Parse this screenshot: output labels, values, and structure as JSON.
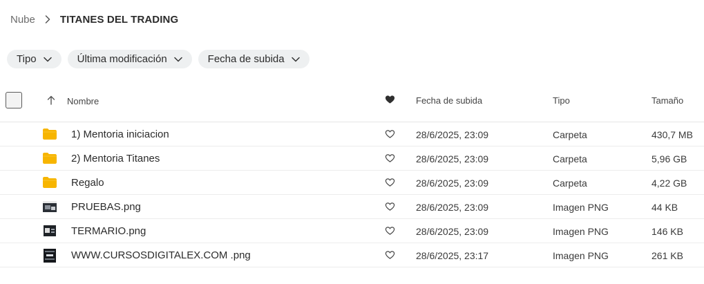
{
  "breadcrumb": {
    "root": "Nube",
    "current": "TITANES DEL TRADING"
  },
  "filters": [
    {
      "label": "Tipo"
    },
    {
      "label": "Última modificación"
    },
    {
      "label": "Fecha de subida"
    }
  ],
  "table": {
    "headers": {
      "name": "Nombre",
      "date": "Fecha de subida",
      "type": "Tipo",
      "size": "Tamaño"
    },
    "rows": [
      {
        "icon": "folder-icon",
        "name": "1) Mentoria iniciacion",
        "date": "28/6/2025, 23:09",
        "type": "Carpeta",
        "size": "430,7 MB"
      },
      {
        "icon": "folder-icon",
        "name": "2) Mentoria Titanes",
        "date": "28/6/2025, 23:09",
        "type": "Carpeta",
        "size": "5,96 GB"
      },
      {
        "icon": "folder-icon",
        "name": "Regalo",
        "date": "28/6/2025, 23:09",
        "type": "Carpeta",
        "size": "4,22 GB"
      },
      {
        "icon": "image-thumbnail-icon",
        "name": "PRUEBAS.png",
        "date": "28/6/2025, 23:09",
        "type": "Imagen PNG",
        "size": "44 KB"
      },
      {
        "icon": "image-thumbnail-icon",
        "name": "TERMARIO.png",
        "date": "28/6/2025, 23:09",
        "type": "Imagen PNG",
        "size": "146 KB"
      },
      {
        "icon": "image-thumbnail-icon",
        "name": "WWW.CURSOSDIGITALEX.COM .png",
        "date": "28/6/2025, 23:17",
        "type": "Imagen PNG",
        "size": "261 KB"
      }
    ]
  },
  "colors": {
    "folder": "#f7b500",
    "chip_bg": "#eef0f1",
    "text": "#2b2b2b",
    "muted": "#6b6b6b"
  }
}
